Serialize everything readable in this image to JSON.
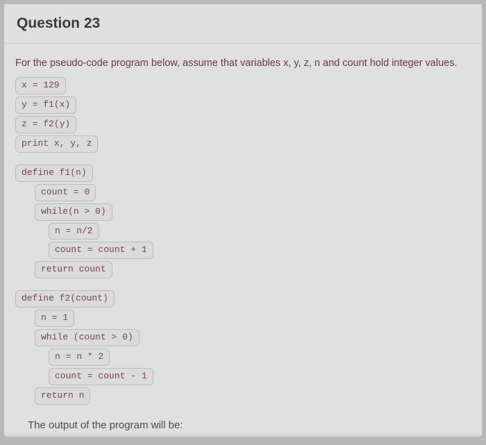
{
  "header": {
    "title": "Question 23"
  },
  "prompt": "For the pseudo-code program below, assume that variables x, y, z, n and count hold integer values.",
  "code_main": {
    "l1": "x = 129",
    "l2": "y = f1(x)",
    "l3": "z = f2(y)",
    "l4": "print x, y, z"
  },
  "code_f1": {
    "l1": "define f1(n)",
    "l2": "count = 0",
    "l3": "while(n > 0)",
    "l4": "n = n/2",
    "l5": "count = count + 1",
    "l6": "return count"
  },
  "code_f2": {
    "l1": "define f2(count)",
    "l2": "n = 1",
    "l3": "while (count > 0)",
    "l4": "n = n * 2",
    "l5": "count = count - 1",
    "l6": "return n"
  },
  "output_prompt": "The output of the program will be:"
}
